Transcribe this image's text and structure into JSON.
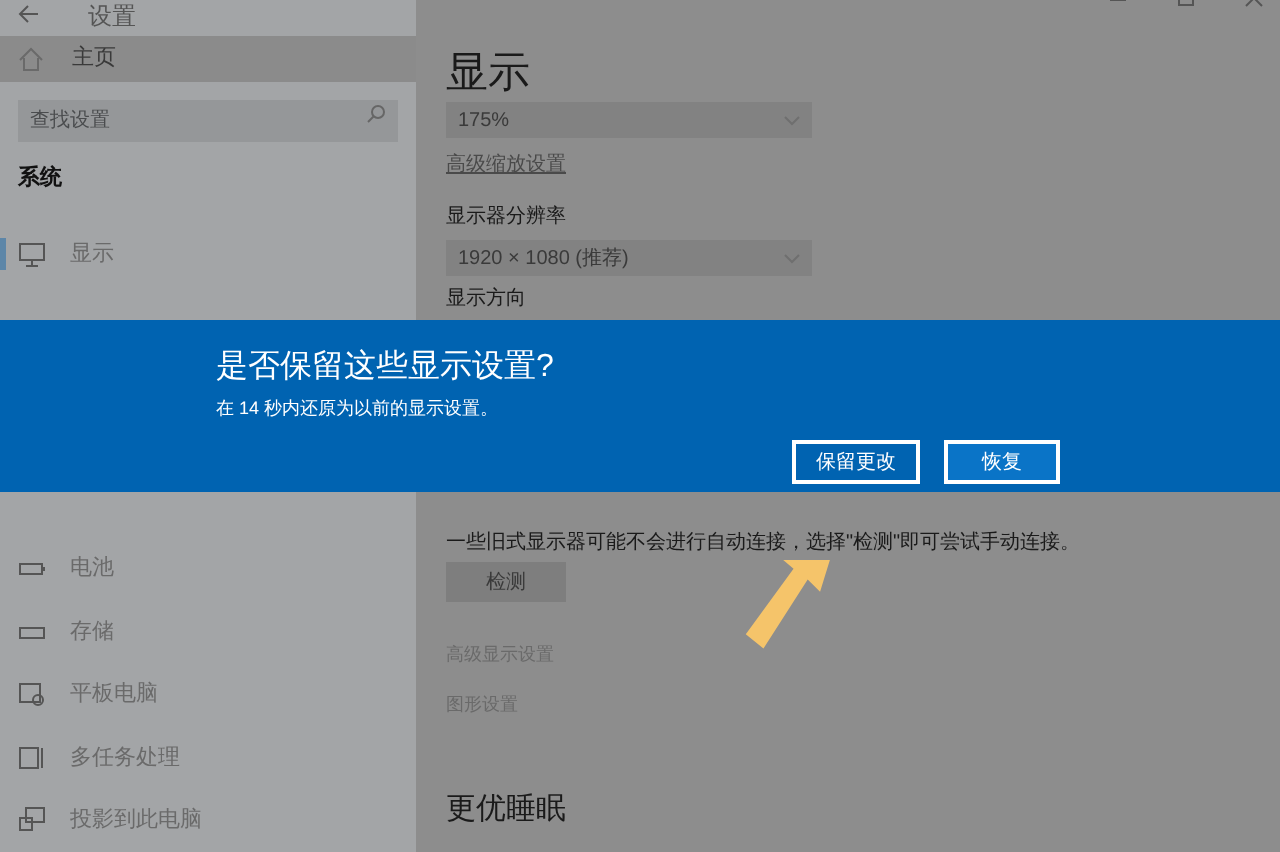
{
  "window": {
    "title": "设置"
  },
  "sidebar": {
    "home": "主页",
    "search": {
      "placeholder": "查找设置"
    },
    "section": "系统",
    "items": [
      {
        "label": "显示",
        "selected": true
      },
      {
        "label": "电池",
        "selected": false
      },
      {
        "label": "存储",
        "selected": false
      },
      {
        "label": "平板电脑",
        "selected": false
      },
      {
        "label": "多任务处理",
        "selected": false
      },
      {
        "label": "投影到此电脑",
        "selected": false
      }
    ]
  },
  "main": {
    "title": "显示",
    "scale_value": "175%",
    "scale_link": "高级缩放设置",
    "resolution_label": "显示器分辨率",
    "resolution_value": "1920 × 1080 (推荐)",
    "orientation_label": "显示方向",
    "detect_text": "一些旧式显示器可能不会进行自动连接，选择\"检测\"即可尝试手动连接。",
    "detect_button": "检测",
    "links": [
      "高级显示设置",
      "图形设置"
    ],
    "sleep_heading": "更优睡眠"
  },
  "dialog": {
    "title": "是否保留这些显示设置?",
    "message": "在 14 秒内还原为以前的显示设置。",
    "buttons": [
      {
        "label": "保留更改",
        "selected": true
      },
      {
        "label": "恢复",
        "selected": false
      }
    ]
  }
}
